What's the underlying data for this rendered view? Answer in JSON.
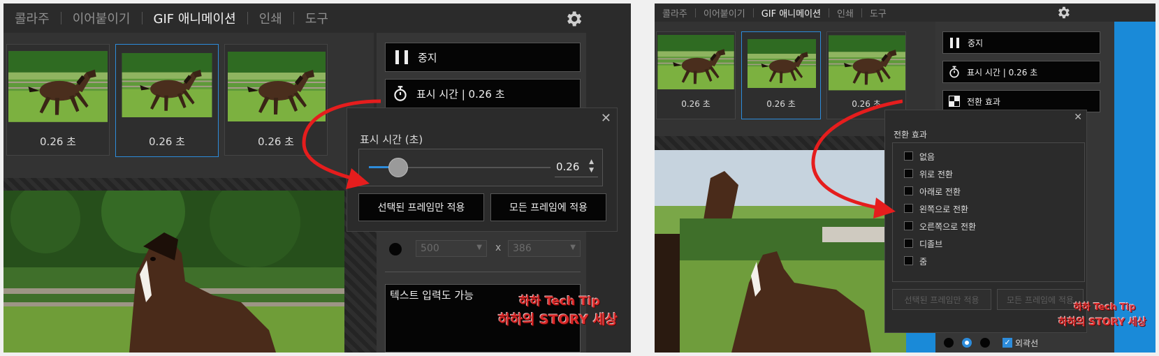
{
  "tabs": [
    "콜라주",
    "이어붙이기",
    "GIF 애니메이션",
    "인쇄",
    "도구"
  ],
  "frames": [
    {
      "duration": "0.26 초"
    },
    {
      "duration": "0.26 초"
    },
    {
      "duration": "0.26 초"
    }
  ],
  "controls": {
    "stop": "중지",
    "display_time": "표시 시간 | 0.26 초",
    "transition": "전환 효과"
  },
  "display_popup": {
    "title": "표시 시간 (초)",
    "value": "0.26",
    "slider_fraction": 0.1,
    "apply_selected": "선택된 프레임만 적용",
    "apply_all": "모든 프레임에 적용"
  },
  "size_row": {
    "width": "500",
    "x": "x",
    "height": "386"
  },
  "text_input": "텍스트 입력도 가능",
  "watermark": [
    "하하 Tech Tip",
    "하하의 STORY 세상"
  ],
  "transition_popup": {
    "title": "전환 효과",
    "options": [
      "없음",
      "위로 전환",
      "아래로 전환",
      "왼쪽으로 전환",
      "오른쪽으로 전환",
      "디졸브",
      "줌"
    ],
    "apply_selected": "선택된 프레임만 적용",
    "apply_all": "모든 프레임에 적용",
    "outline_label": "외곽선"
  },
  "colors": {
    "accent": "#2d8cdb",
    "arrow": "#e51d1d"
  }
}
